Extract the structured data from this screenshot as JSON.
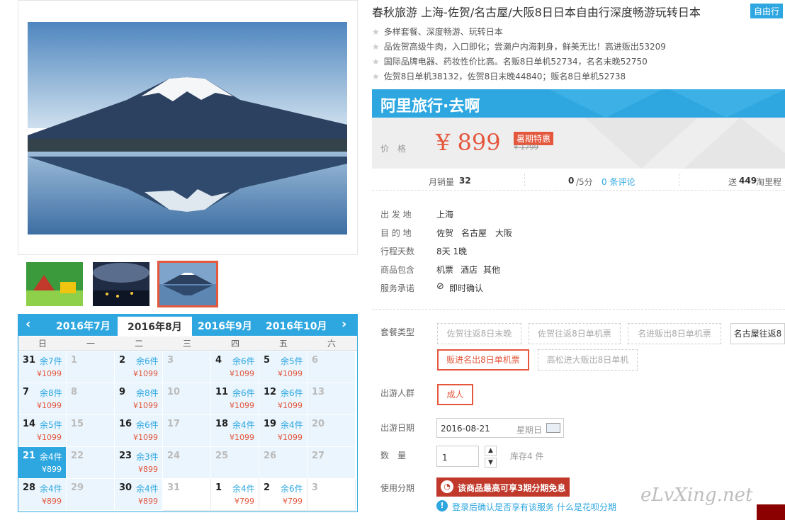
{
  "gallery": {
    "thumbs": [
      "thumb-1",
      "thumb-2",
      "thumb-3"
    ]
  },
  "calendar": {
    "prev": "‹",
    "next": "›",
    "months": [
      "2016年7月",
      "2016年8月",
      "2016年9月",
      "2016年10月"
    ],
    "weekdays": [
      "日",
      "一",
      "二",
      "三",
      "四",
      "五",
      "六"
    ],
    "rows": [
      [
        {
          "d": "31",
          "s": "余7件",
          "p": "¥1099"
        },
        {
          "d": "1"
        },
        {
          "d": "2",
          "s": "余6件",
          "p": "¥1099"
        },
        {
          "d": "3"
        },
        {
          "d": "4",
          "s": "余6件",
          "p": "¥1099"
        },
        {
          "d": "5",
          "s": "余5件",
          "p": "¥1099"
        },
        {
          "d": "6"
        }
      ],
      [
        {
          "d": "7",
          "s": "余8件",
          "p": "¥1099"
        },
        {
          "d": "8"
        },
        {
          "d": "9",
          "s": "余8件",
          "p": "¥1099"
        },
        {
          "d": "10"
        },
        {
          "d": "11",
          "s": "余6件",
          "p": "¥1099"
        },
        {
          "d": "12",
          "s": "余6件",
          "p": "¥1099"
        },
        {
          "d": "13"
        }
      ],
      [
        {
          "d": "14",
          "s": "余5件",
          "p": "¥1099"
        },
        {
          "d": "15"
        },
        {
          "d": "16",
          "s": "余6件",
          "p": "¥1099"
        },
        {
          "d": "17"
        },
        {
          "d": "18",
          "s": "余4件",
          "p": "¥1099"
        },
        {
          "d": "19",
          "s": "余4件",
          "p": "¥1099"
        },
        {
          "d": "20"
        }
      ],
      [
        {
          "d": "21",
          "s": "余4件",
          "p": "¥899"
        },
        {
          "d": "22"
        },
        {
          "d": "23",
          "s": "余3件",
          "p": "¥899"
        },
        {
          "d": "24"
        },
        {
          "d": "25"
        },
        {
          "d": "26"
        },
        {
          "d": "27"
        }
      ],
      [
        {
          "d": "28",
          "s": "余4件",
          "p": "¥899"
        },
        {
          "d": "29"
        },
        {
          "d": "30",
          "s": "余4件",
          "p": "¥899"
        },
        {
          "d": "31"
        },
        {
          "d": "1",
          "s": "余4件",
          "p": "¥799"
        },
        {
          "d": "2",
          "s": "余6件",
          "p": "¥799"
        },
        {
          "d": "3"
        }
      ]
    ]
  },
  "product": {
    "title": "春秋旅游 上海-佐贺/名古屋/大阪8日日本自由行深度畅游玩转日本",
    "badge": "自由行",
    "features": [
      "多样套餐、深度畅游、玩转日本",
      "品佐贺高级牛肉，入口即化；尝濑户内海刺身，鲜美无比！高进贩出53209",
      "国际品牌电器、药妆性价比高。名贩8日单机52734，名名末晚52750",
      "佐贺8日单机38132，佐贺8日末晚44840；贩名8日单机52738"
    ],
    "banner": "阿里旅行·去啊",
    "price_label": "价　格",
    "price": "¥ 899",
    "promo": "暑期特惠",
    "old_price": "¥ 1799",
    "sales_label": "月销量",
    "sales": "32",
    "rating": "0",
    "rating_unit": "/5分",
    "reviews": "0 条评论",
    "points_prefix": "送",
    "points": "449",
    "points_suffix": "淘里程"
  },
  "info": [
    {
      "k": "出 发 地",
      "v": [
        "上海"
      ]
    },
    {
      "k": "目 的 地",
      "v": [
        "佐贺",
        "名古屋",
        "大阪"
      ]
    },
    {
      "k": "行程天数",
      "v": [
        "8天 1晚"
      ]
    },
    {
      "k": "商品包含",
      "v": [
        "机票",
        "酒店",
        "其他"
      ]
    },
    {
      "k": "服务承诺",
      "v": [
        "即时确认"
      ]
    }
  ],
  "options": {
    "package_label": "套餐类型",
    "packages": [
      "佐贺往返8日末晚",
      "佐贺往返8日单机票",
      "名进贩出8日单机票",
      "名古屋往返8",
      "贩进名出8日单机票",
      "高松进大贩出8日单机"
    ],
    "people_label": "出游人群",
    "people": "成人",
    "date_label": "出游日期",
    "date": "2016-08-21",
    "weekday": "星期日",
    "qty_label": "数　量",
    "qty": "1",
    "stock": "库存4 件",
    "install_label": "使用分期",
    "install": "该商品最高可享3期分期免息",
    "install_note": "登录后确认是否享有该服务",
    "install_link": "什么是花呗分期"
  },
  "watermark": "eLvXing.net",
  "colors": {
    "accent": "#2ea7e0",
    "price": "#e4573d"
  }
}
